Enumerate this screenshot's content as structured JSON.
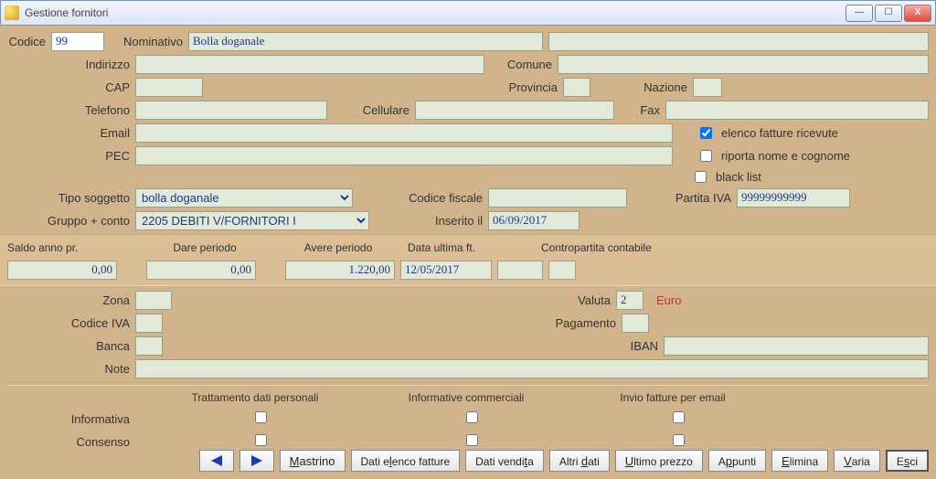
{
  "window": {
    "title": "Gestione fornitori",
    "min": "—",
    "max": "☐",
    "close": "X"
  },
  "labels": {
    "codice": "Codice",
    "nominativo": "Nominativo",
    "indirizzo": "Indirizzo",
    "comune": "Comune",
    "cap": "CAP",
    "provincia": "Provincia",
    "nazione": "Nazione",
    "telefono": "Telefono",
    "cellulare": "Cellulare",
    "fax": "Fax",
    "email": "Email",
    "pec": "PEC",
    "chk_elenco": "elenco fatture ricevute",
    "chk_riporta": "riporta nome e cognome",
    "chk_black": "black list",
    "tipo_soggetto": "Tipo soggetto",
    "codice_fiscale": "Codice fiscale",
    "partita_iva": "Partita IVA",
    "gruppo_conto": "Gruppo + conto",
    "inserito_il": "Inserito il",
    "saldo": "Saldo anno pr.",
    "dare": "Dare periodo",
    "avere": "Avere periodo",
    "data_ult": "Data ultima ft.",
    "contro": "Contropartita contabile",
    "zona": "Zona",
    "valuta": "Valuta",
    "valuta_desc": "Euro",
    "codice_iva": "Codice IVA",
    "pagamento": "Pagamento",
    "banca": "Banca",
    "iban": "IBAN",
    "note": "Note",
    "tratt": "Trattamento dati personali",
    "infocomm": "Informative commerciali",
    "invio": "Invio fatture per email",
    "informativa": "Informativa",
    "consenso": "Consenso"
  },
  "values": {
    "codice": "99",
    "nominativo": "Bolla doganale",
    "nominativo2": "",
    "indirizzo": "",
    "comune": "",
    "cap": "",
    "provincia": "",
    "nazione": "",
    "telefono": "",
    "cellulare": "",
    "fax": "",
    "email": "",
    "pec": "",
    "tipo_soggetto": "bolla doganale",
    "codice_fiscale": "",
    "partita_iva": "99999999999",
    "gruppo_conto": "2205 DEBITI V/FORNITORI I",
    "inserito_il": "06/09/2017",
    "saldo": "0,00",
    "dare": "0,00",
    "avere": "1.220,00",
    "data_ult": "12/05/2017",
    "contro": "",
    "zona": "",
    "valuta": "2",
    "codice_iva": "",
    "pagamento": "",
    "banca": "",
    "iban": "",
    "note": ""
  },
  "checks": {
    "elenco": true,
    "riporta": false,
    "black": false
  },
  "buttons": {
    "mastrino": "Mastrino",
    "dati_elenco": "Dati elenco fatture",
    "dati_vendita": "Dati vendita",
    "altri_dati": "Altri dati",
    "ultimo_prezzo": "Ultimo prezzo",
    "appunti": "Appunti",
    "elimina": "Elimina",
    "varia": "Varia",
    "esci": "Esci"
  }
}
